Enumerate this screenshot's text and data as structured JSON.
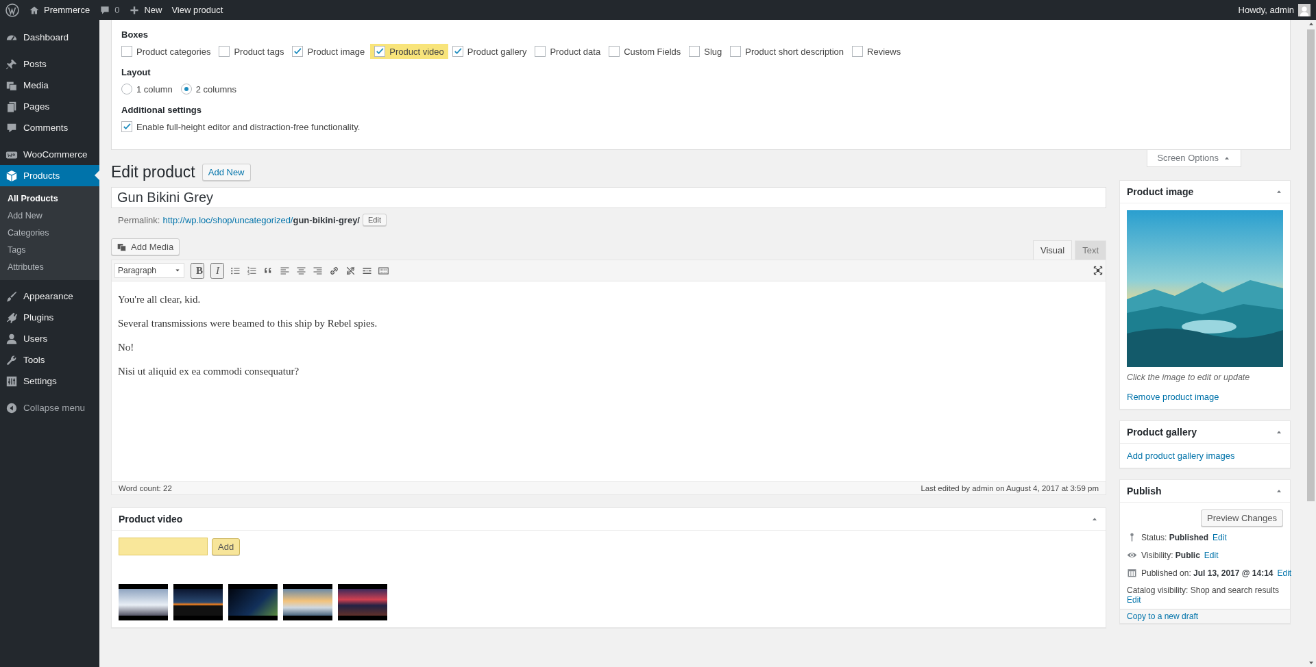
{
  "admin_bar": {
    "site": "Premmerce",
    "comments": "0",
    "new": "New",
    "view": "View product",
    "greeting": "Howdy, admin"
  },
  "sidebar": {
    "sections": [
      {
        "items": [
          {
            "label": "Dashboard",
            "selected": false
          }
        ]
      },
      {
        "items": [
          {
            "label": "Posts",
            "selected": false
          },
          {
            "label": "Media",
            "selected": false
          },
          {
            "label": "Pages",
            "selected": false
          },
          {
            "label": "Comments",
            "selected": false
          }
        ]
      },
      {
        "items": [
          {
            "label": "WooCommerce",
            "selected": false
          },
          {
            "label": "Products",
            "selected": true,
            "children": [
              {
                "label": "All Products",
                "selected": true
              },
              {
                "label": "Add New",
                "selected": false
              },
              {
                "label": "Categories",
                "selected": false
              },
              {
                "label": "Tags",
                "selected": false
              },
              {
                "label": "Attributes",
                "selected": false
              }
            ]
          }
        ]
      },
      {
        "items": [
          {
            "label": "Appearance",
            "selected": false
          },
          {
            "label": "Plugins",
            "selected": false
          },
          {
            "label": "Users",
            "selected": false
          },
          {
            "label": "Tools",
            "selected": false
          },
          {
            "label": "Settings",
            "selected": false
          }
        ]
      }
    ],
    "collapse": "Collapse menu"
  },
  "screen_options": {
    "boxes_label": "Boxes",
    "boxes": [
      {
        "label": "Product categories",
        "checked": false,
        "highlighted": false
      },
      {
        "label": "Product tags",
        "checked": false,
        "highlighted": false
      },
      {
        "label": "Product image",
        "checked": true,
        "highlighted": false
      },
      {
        "label": "Product video",
        "checked": true,
        "highlighted": true
      },
      {
        "label": "Product gallery",
        "checked": true,
        "highlighted": false
      },
      {
        "label": "Product data",
        "checked": false,
        "highlighted": false
      },
      {
        "label": "Custom Fields",
        "checked": false,
        "highlighted": false
      },
      {
        "label": "Slug",
        "checked": false,
        "highlighted": false
      },
      {
        "label": "Product short description",
        "checked": false,
        "highlighted": false
      },
      {
        "label": "Reviews",
        "checked": false,
        "highlighted": false
      }
    ],
    "layout_label": "Layout",
    "layout": [
      {
        "label": "1 column",
        "selected": false
      },
      {
        "label": "2 columns",
        "selected": true
      }
    ],
    "additional_label": "Additional settings",
    "additional": [
      {
        "label": "Enable full-height editor and distraction-free functionality.",
        "checked": true
      }
    ],
    "tab": "Screen Options"
  },
  "page": {
    "heading": "Edit product",
    "add_new": "Add New",
    "title": "Gun Bikini Grey",
    "permalink_label": "Permalink:",
    "permalink": "http://wp.loc/shop/uncategorized/**gun-bikini-grey/**",
    "permalink_edit": "Edit"
  },
  "editor": {
    "add_media": "Add Media",
    "tabs": [
      {
        "label": "Visual",
        "selected": true
      },
      {
        "label": "Text",
        "selected": false
      }
    ],
    "format": "Paragraph",
    "toolbar": [
      {
        "kind": "bold",
        "glyph": "B"
      },
      {
        "kind": "italic",
        "glyph": "I"
      },
      {
        "kind": "bullets"
      },
      {
        "kind": "numbers"
      },
      {
        "kind": "quote"
      },
      {
        "kind": "align-left"
      },
      {
        "kind": "align-center"
      },
      {
        "kind": "align-right"
      },
      {
        "kind": "link"
      },
      {
        "kind": "unlink"
      },
      {
        "kind": "more"
      },
      {
        "kind": "keyboard"
      }
    ],
    "paragraphs": [
      "You're all clear, kid.",
      "Several transmissions were beamed to this ship by Rebel spies.",
      "No!",
      "Nisi ut aliquid ex ea commodi consequatur?"
    ],
    "word_count": "Word count: 22",
    "last_edited": "Last edited by admin on August 4, 2017 at 3:59 pm"
  },
  "product_video": {
    "title": "Product video",
    "highlighted": true,
    "add": "Add"
  },
  "product_image": {
    "title": "Product image",
    "caption": "Click the image to edit or update",
    "remove": "Remove product image"
  },
  "product_gallery": {
    "title": "Product gallery",
    "add": "Add product gallery images"
  },
  "publish": {
    "title": "Publish",
    "preview": "Preview Changes",
    "rows": [
      {
        "kind": "status",
        "label": "Status:",
        "value": "Published",
        "edit": "Edit"
      },
      {
        "kind": "visibility",
        "label": "Visibility:",
        "value": "Public",
        "edit": "Edit"
      },
      {
        "kind": "date",
        "label": "Published on:",
        "value": "Jul 13, 2017 @ 14:14",
        "edit": "Edit"
      },
      {
        "kind": "catalog",
        "label": "Catalog visibility:",
        "value": "Shop and search results",
        "edit": "Edit"
      }
    ],
    "copy": "Copy to a new draft"
  }
}
